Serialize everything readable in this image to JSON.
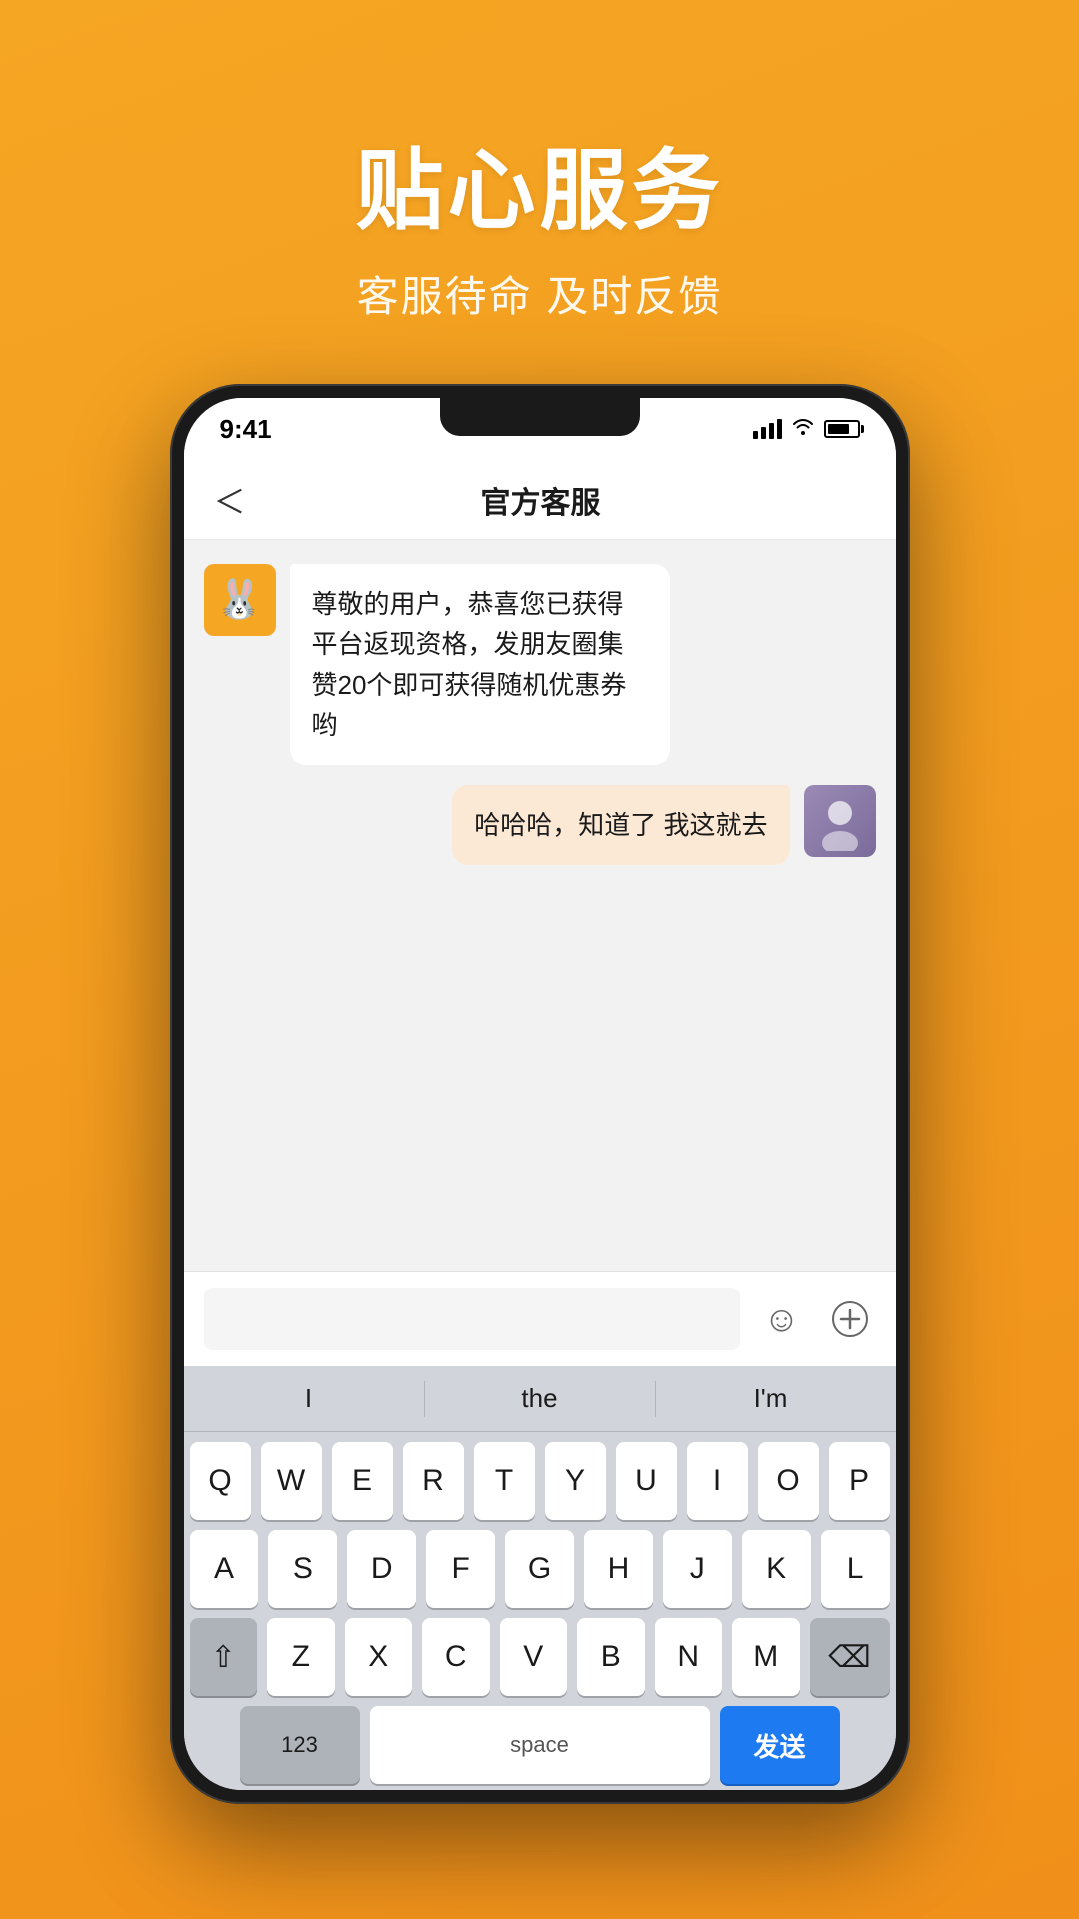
{
  "page": {
    "background_color": "#f5a623"
  },
  "header": {
    "title": "贴心服务",
    "subtitle": "客服待命 及时反馈"
  },
  "phone": {
    "status_bar": {
      "time": "9:41",
      "signal": "▂▄▆█",
      "wifi": "wifi",
      "battery": "battery"
    },
    "nav": {
      "back_label": "<",
      "title": "官方客服"
    },
    "messages": [
      {
        "id": "msg1",
        "type": "bot",
        "text": "尊敬的用户，恭喜您已获得平台返现资格，发朋友圈集赞20个即可获得随机优惠券哟"
      },
      {
        "id": "msg2",
        "type": "user",
        "text": "哈哈哈，知道了 我这就去"
      }
    ],
    "input": {
      "placeholder": "",
      "emoji_label": "☺",
      "add_label": "+"
    },
    "keyboard": {
      "suggestions": [
        "I",
        "the",
        "I'm"
      ],
      "rows": [
        [
          "Q",
          "W",
          "E",
          "R",
          "T",
          "Y",
          "U",
          "I",
          "O",
          "P"
        ],
        [
          "A",
          "S",
          "D",
          "F",
          "G",
          "H",
          "J",
          "K",
          "L"
        ],
        [
          "⇧",
          "Z",
          "X",
          "C",
          "V",
          "B",
          "N",
          "M",
          "⌫"
        ],
        [
          "123",
          "space",
          "发送"
        ]
      ]
    }
  }
}
